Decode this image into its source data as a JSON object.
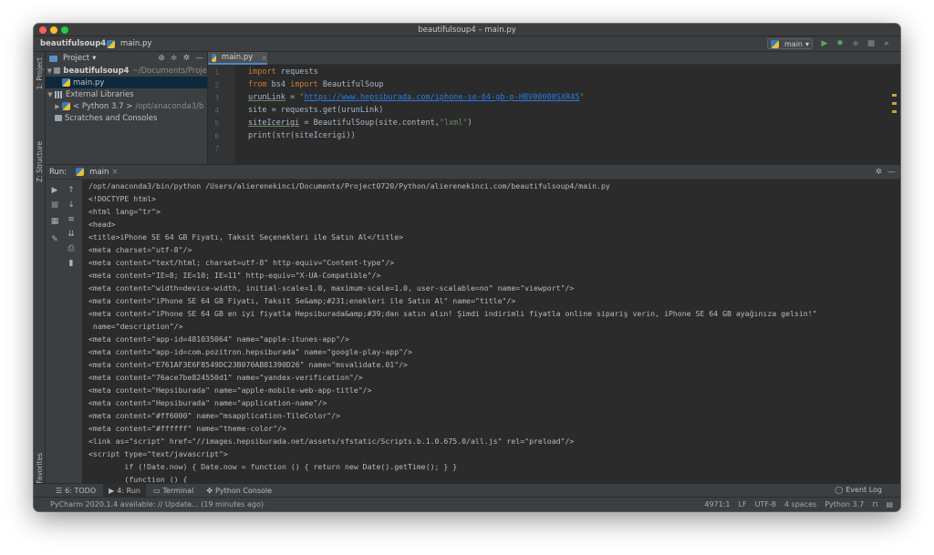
{
  "window": {
    "title": "beautifulsoup4 – main.py"
  },
  "navbar": {
    "project_name": "beautifulsoup4",
    "file_name": "main.py",
    "run_config": "main"
  },
  "side_tabs": {
    "project": "1: Project",
    "structure": "Z: Structure",
    "favorites": "2: Favorites"
  },
  "project_panel": {
    "title": "Project",
    "tree": [
      {
        "label": "beautifulsoup4",
        "path": "~/Documents/Proje"
      },
      {
        "label": "main.py"
      },
      {
        "label": "External Libraries"
      },
      {
        "label": "< Python 3.7 >",
        "path": "/opt/anaconda3/b"
      },
      {
        "label": "Scratches and Consoles"
      }
    ]
  },
  "editor": {
    "tab_label": "main.py",
    "line_numbers": [
      "1",
      "2",
      "3",
      "4",
      "5",
      "6",
      "7"
    ],
    "code": {
      "l1_kw": "import",
      "l1_rest": " requests",
      "l2_kw1": "from",
      "l2_mid": " bs4 ",
      "l2_kw2": "import",
      "l2_rest": " BeautifulSoup",
      "l3_var": "urunLink",
      "l3_eq": " = ",
      "l3_q1": "\"",
      "l3_url": "https://www.hepsiburada.com/iphone-se-64-gb-p-HBV00000SXR45",
      "l3_q2": "\"",
      "l4": "site = requests.get(urunLink)",
      "l5_var": "siteIcerigi",
      "l5_mid": " = BeautifulSoup(site.content,",
      "l5_str": "\"lxml\"",
      "l5_end": ")",
      "l6": "print(str(siteIcerigi))"
    }
  },
  "run_panel": {
    "label": "Run:",
    "tab": "main"
  },
  "console": {
    "lines": [
      "/opt/anaconda3/bin/python /Users/alierenekinci/Documents/Project0720/Python/alierenekinci.com/beautifulsoup4/main.py",
      "<!DOCTYPE html>",
      "<html lang=\"tr\">",
      "<head>",
      "<title>iPhone SE 64 GB Fiyatı, Taksit Seçenekleri ile Satın Al</title>",
      "<meta charset=\"utf-8\"/>",
      "<meta content=\"text/html; charset=utf-8\" http-equiv=\"Content-type\"/>",
      "<meta content=\"IE=8; IE=10; IE=11\" http-equiv=\"X-UA-Compatible\"/>",
      "<meta content=\"width=device-width, initial-scale=1.0, maximum-scale=1.0, user-scalable=no\" name=\"viewport\"/>",
      "<meta content=\"iPhone SE 64 GB Fiyatı, Taksit Se&amp;#231;enekleri ile Satın Al\" name=\"title\"/>",
      "<meta content=\"iPhone SE 64 GB en iyi fiyatla Hepsiburada&amp;#39;dan satın alın! Şimdi indirimli fiyatla online sipariş verin, iPhone SE 64 GB ayağınıza gelsin!\"",
      " name=\"description\"/>",
      "<meta content=\"app-id=481035064\" name=\"apple-itunes-app\"/>",
      "<meta content=\"app-id=com.pozitron.hepsiburada\" name=\"google-play-app\"/>",
      "<meta content=\"E761AF3E6F8549DC23B070AB81390D26\" name=\"msvalidate.01\"/>",
      "<meta content=\"76ace7be824550d1\" name=\"yandex-verification\"/>",
      "<meta content=\"Hepsiburada\" name=\"apple-mobile-web-app-title\"/>",
      "<meta content=\"Hepsiburada\" name=\"application-name\"/>",
      "<meta content=\"#ff6000\" name=\"msapplication-TileColor\"/>",
      "<meta content=\"#ffffff\" name=\"theme-color\"/>",
      "<link as=\"script\" href=\"//images.hepsiburada.net/assets/sfstatic/Scripts.b.1.0.675.0/all.js\" rel=\"preload\"/>",
      "<script type=\"text/javascript\">",
      "        if (!Date.now) { Date.now = function () { return new Date().getTime(); } }",
      "        (function () {"
    ]
  },
  "bottom_tabs": {
    "todo": "6: TODO",
    "run": "4: Run",
    "terminal": "Terminal",
    "python_console": "Python Console",
    "event_log": "Event Log"
  },
  "statusbar": {
    "message": "PyCharm 2020.1.4 available: // Update... (19 minutes ago)",
    "position": "4971:1",
    "line_sep": "LF",
    "encoding": "UTF-8",
    "indent": "4 spaces",
    "interpreter": "Python 3.7"
  },
  "icons": {
    "close": "traffic-red",
    "minimize": "traffic-yellow",
    "maximize": "traffic-green",
    "run": "play-icon",
    "debug": "bug-icon",
    "search": "search-icon",
    "settings": "gear-icon"
  },
  "colors": {
    "keyword": "#cc7832",
    "string": "#6a8759",
    "url": "#287bde",
    "background": "#2b2b2b",
    "panel": "#3c3f41"
  }
}
